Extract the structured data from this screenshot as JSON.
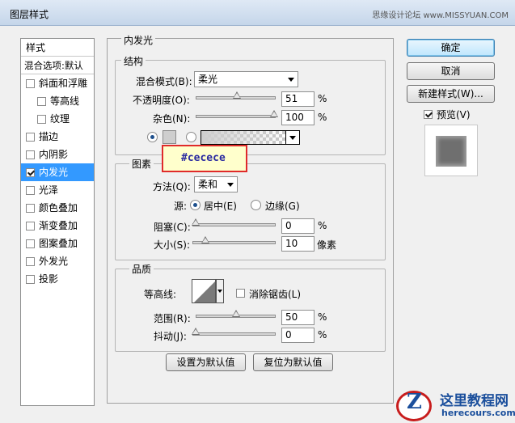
{
  "window": {
    "title": "图层样式",
    "watermark": "思缘设计论坛 www.MISSYUAN.COM"
  },
  "sidebar": {
    "header": "样式",
    "blend_options": "混合选项:默认",
    "items": [
      {
        "label": "斜面和浮雕",
        "checked": false,
        "sub": false
      },
      {
        "label": "等高线",
        "checked": false,
        "sub": true
      },
      {
        "label": "纹理",
        "checked": false,
        "sub": true
      },
      {
        "label": "描边",
        "checked": false,
        "sub": false
      },
      {
        "label": "内阴影",
        "checked": false,
        "sub": false
      },
      {
        "label": "内发光",
        "checked": true,
        "sub": false,
        "selected": true
      },
      {
        "label": "光泽",
        "checked": false,
        "sub": false
      },
      {
        "label": "颜色叠加",
        "checked": false,
        "sub": false
      },
      {
        "label": "渐变叠加",
        "checked": false,
        "sub": false
      },
      {
        "label": "图案叠加",
        "checked": false,
        "sub": false
      },
      {
        "label": "外发光",
        "checked": false,
        "sub": false
      },
      {
        "label": "投影",
        "checked": false,
        "sub": false
      }
    ]
  },
  "panel": {
    "title": "内发光",
    "structure": {
      "title": "结构",
      "blend_mode_label": "混合模式(B):",
      "blend_mode_value": "柔光",
      "opacity_label": "不透明度(O):",
      "opacity_value": "51",
      "opacity_unit": "%",
      "noise_label": "杂色(N):",
      "noise_value": "100",
      "noise_unit": "%",
      "glow_color": "#cecece"
    },
    "tooltip": "#cecece",
    "elements": {
      "title": "图素",
      "method_label": "方法(Q):",
      "method_value": "柔和",
      "source_label": "源:",
      "source_center": "居中(E)",
      "source_edge": "边缘(G)",
      "choke_label": "阻塞(C):",
      "choke_value": "0",
      "choke_unit": "%",
      "size_label": "大小(S):",
      "size_value": "10",
      "size_unit": "像素"
    },
    "quality": {
      "title": "品质",
      "contour_label": "等高线:",
      "antialias_label": "消除锯齿(L)",
      "range_label": "范围(R):",
      "range_value": "50",
      "range_unit": "%",
      "jitter_label": "抖动(J):",
      "jitter_value": "0",
      "jitter_unit": "%"
    },
    "set_default": "设置为默认值",
    "reset_default": "复位为默认值"
  },
  "buttons": {
    "ok": "确定",
    "cancel": "取消",
    "new_style": "新建样式(W)...",
    "preview": "预览(V)"
  },
  "logo": {
    "text_cn": "这里教程网",
    "url": "herecours.com",
    "letter": "Z"
  }
}
